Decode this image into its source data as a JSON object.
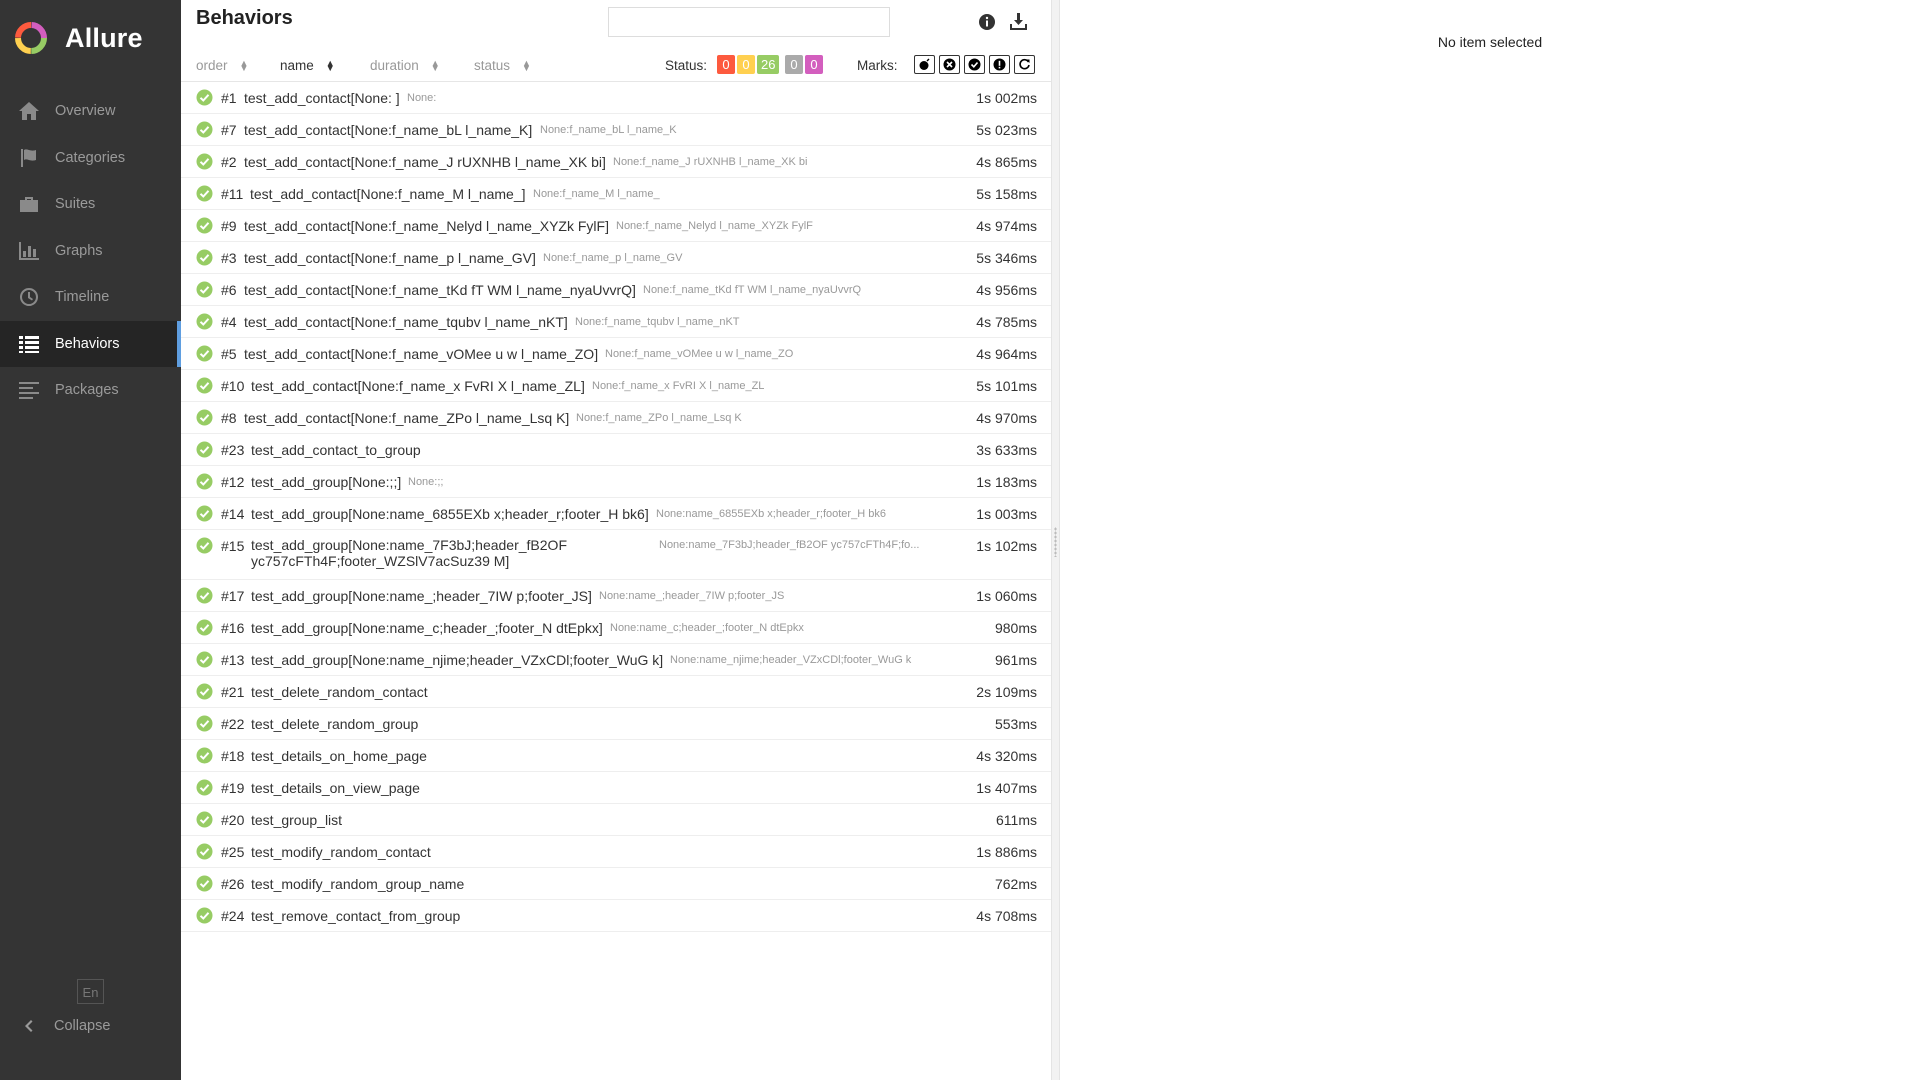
{
  "app": {
    "name": "Allure"
  },
  "sidebar": {
    "items": [
      {
        "label": "Overview",
        "icon": "home-icon"
      },
      {
        "label": "Categories",
        "icon": "flag-icon"
      },
      {
        "label": "Suites",
        "icon": "briefcase-icon"
      },
      {
        "label": "Graphs",
        "icon": "bar-chart-icon"
      },
      {
        "label": "Timeline",
        "icon": "clock-icon"
      },
      {
        "label": "Behaviors",
        "icon": "list-icon",
        "active": true
      },
      {
        "label": "Packages",
        "icon": "align-left-icon"
      }
    ],
    "language": "En",
    "collapse_label": "Collapse"
  },
  "pane": {
    "title": "Behaviors",
    "search_value": "",
    "sort": {
      "order": "order",
      "name": "name",
      "duration": "duration",
      "status": "status",
      "active": "name"
    },
    "status_label": "Status:",
    "status_counts": [
      {
        "status": "failed",
        "count": "0",
        "color": "#fd5a3e"
      },
      {
        "status": "broken",
        "count": "0",
        "color": "#ffd050"
      },
      {
        "status": "passed",
        "count": "26",
        "color": "#97cc64"
      },
      {
        "status": "skipped",
        "count": "0",
        "color": "#aaaaaa"
      },
      {
        "status": "unknown",
        "count": "0",
        "color": "#d35ebe"
      }
    ],
    "marks_label": "Marks:",
    "marks": [
      "flaky-mark-icon",
      "new-failed-mark-icon",
      "new-passed-mark-icon",
      "new-broken-mark-icon",
      "retries-mark-icon"
    ]
  },
  "tests": [
    {
      "num": "#1",
      "name": "test_add_contact[None: ]",
      "param": "None:",
      "duration": "1s 002ms"
    },
    {
      "num": "#7",
      "name": "test_add_contact[None:f_name_bL l_name_K]",
      "param": "None:f_name_bL l_name_K",
      "duration": "5s 023ms"
    },
    {
      "num": "#2",
      "name": "test_add_contact[None:f_name_J rUXNHB l_name_XK bi]",
      "param": "None:f_name_J rUXNHB l_name_XK bi",
      "duration": "4s 865ms"
    },
    {
      "num": "#11",
      "name": "test_add_contact[None:f_name_M l_name_]",
      "param": "None:f_name_M l_name_",
      "duration": "5s 158ms"
    },
    {
      "num": "#9",
      "name": "test_add_contact[None:f_name_Nelyd l_name_XYZk FylF]",
      "param": "None:f_name_Nelyd l_name_XYZk FylF",
      "duration": "4s 974ms"
    },
    {
      "num": "#3",
      "name": "test_add_contact[None:f_name_p l_name_GV]",
      "param": "None:f_name_p l_name_GV",
      "duration": "5s 346ms"
    },
    {
      "num": "#6",
      "name": "test_add_contact[None:f_name_tKd fT WM l_name_nyaUvvrQ]",
      "param": "None:f_name_tKd fT WM l_name_nyaUvvrQ",
      "duration": "4s 956ms"
    },
    {
      "num": "#4",
      "name": "test_add_contact[None:f_name_tqubv l_name_nKT]",
      "param": "None:f_name_tqubv l_name_nKT",
      "duration": "4s 785ms"
    },
    {
      "num": "#5",
      "name": "test_add_contact[None:f_name_vOMee u w l_name_ZO]",
      "param": "None:f_name_vOMee u w l_name_ZO",
      "duration": "4s 964ms"
    },
    {
      "num": "#10",
      "name": "test_add_contact[None:f_name_x FvRI X l_name_ZL]",
      "param": "None:f_name_x FvRI X l_name_ZL",
      "duration": "5s 101ms"
    },
    {
      "num": "#8",
      "name": "test_add_contact[None:f_name_ZPo l_name_Lsq K]",
      "param": "None:f_name_ZPo l_name_Lsq K",
      "duration": "4s 970ms"
    },
    {
      "num": "#23",
      "name": "test_add_contact_to_group",
      "param": "",
      "duration": "3s 633ms"
    },
    {
      "num": "#12",
      "name": "test_add_group[None:;;]",
      "param": "None:;;",
      "duration": "1s 183ms"
    },
    {
      "num": "#14",
      "name": "test_add_group[None:name_6855EXb x;header_r;footer_H bk6]",
      "param": "None:name_6855EXb x;header_r;footer_H bk6",
      "duration": "1s 003ms"
    },
    {
      "num": "#15",
      "name": "test_add_group[None:name_7F3bJ;header_fB2OF yc757cFTh4F;footer_WZSlV7acSuz39 M]",
      "param": "None:name_7F3bJ;header_fB2OF yc757cFTh4F;fo...",
      "duration": "1s 102ms",
      "tall": true
    },
    {
      "num": "#17",
      "name": "test_add_group[None:name_;header_7IW p;footer_JS]",
      "param": "None:name_;header_7IW p;footer_JS",
      "duration": "1s 060ms"
    },
    {
      "num": "#16",
      "name": "test_add_group[None:name_c;header_;footer_N dtEpkx]",
      "param": "None:name_c;header_;footer_N dtEpkx",
      "duration": "980ms"
    },
    {
      "num": "#13",
      "name": "test_add_group[None:name_njime;header_VZxCDl;footer_WuG k]",
      "param": "None:name_njime;header_VZxCDl;footer_WuG k",
      "duration": "961ms"
    },
    {
      "num": "#21",
      "name": "test_delete_random_contact",
      "param": "",
      "duration": "2s 109ms"
    },
    {
      "num": "#22",
      "name": "test_delete_random_group",
      "param": "",
      "duration": "553ms"
    },
    {
      "num": "#18",
      "name": "test_details_on_home_page",
      "param": "",
      "duration": "4s 320ms"
    },
    {
      "num": "#19",
      "name": "test_details_on_view_page",
      "param": "",
      "duration": "1s 407ms"
    },
    {
      "num": "#20",
      "name": "test_group_list",
      "param": "",
      "duration": "611ms"
    },
    {
      "num": "#25",
      "name": "test_modify_random_contact",
      "param": "",
      "duration": "1s 886ms"
    },
    {
      "num": "#26",
      "name": "test_modify_random_group_name",
      "param": "",
      "duration": "762ms"
    },
    {
      "num": "#24",
      "name": "test_remove_contact_from_group",
      "param": "",
      "duration": "4s 708ms"
    }
  ],
  "details": {
    "empty_message": "No item selected"
  }
}
